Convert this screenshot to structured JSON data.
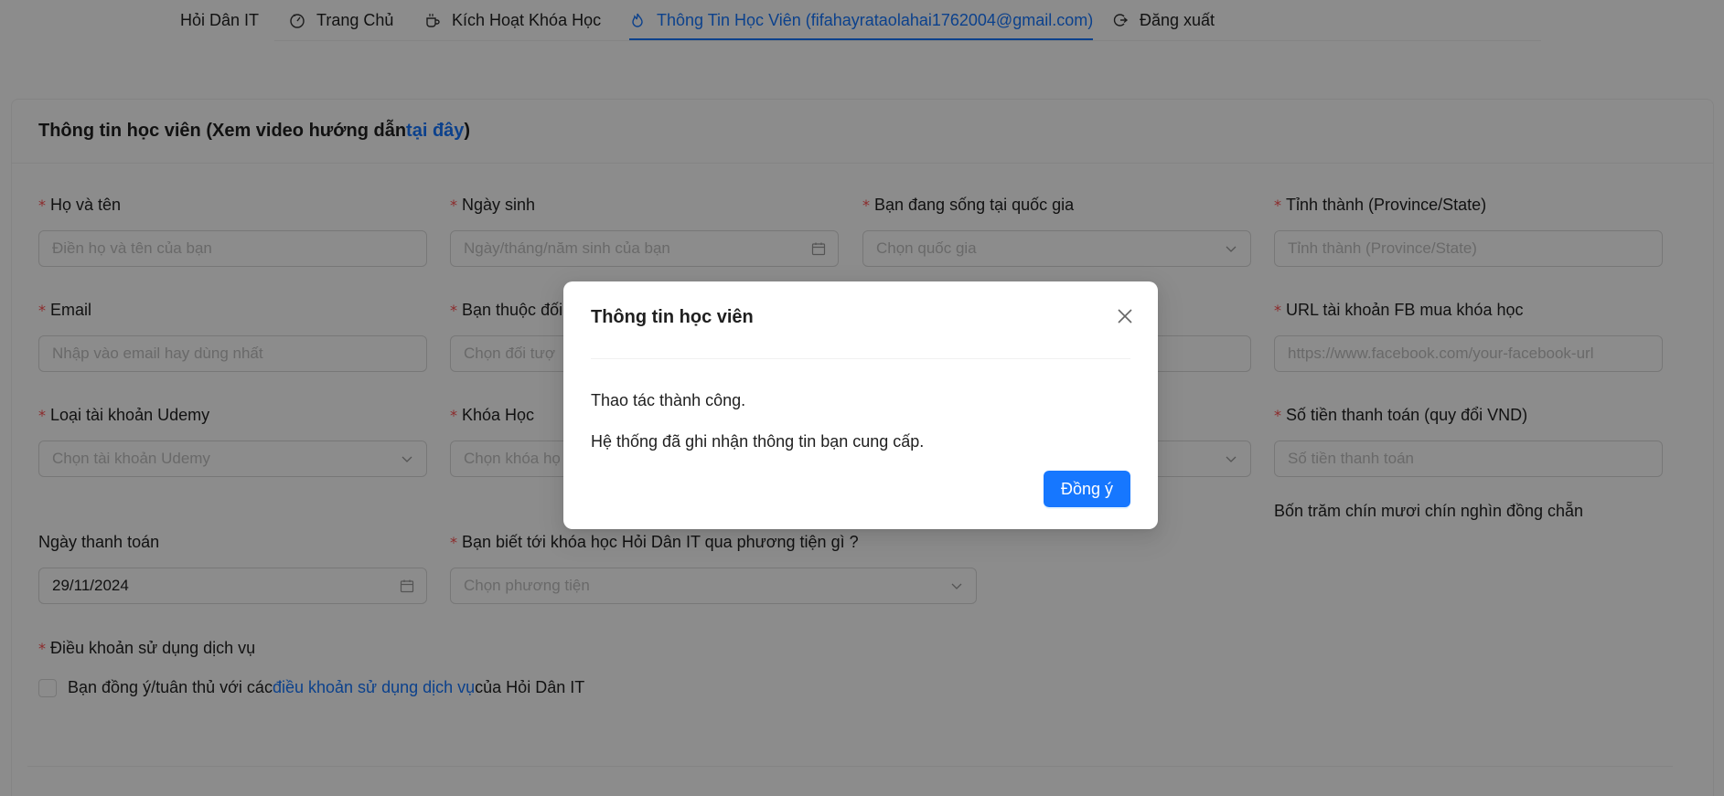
{
  "nav": {
    "items": [
      {
        "label": "Hỏi Dân IT",
        "icon": ""
      },
      {
        "label": "Trang Chủ",
        "icon": "dashboard-icon"
      },
      {
        "label": "Kích Hoạt Khóa Học",
        "icon": "coffee-icon"
      },
      {
        "label": "Thông Tin Học Viên (fifahayrataolahai1762004@gmail.com)",
        "icon": "fire-icon"
      },
      {
        "label": "Đăng xuất",
        "icon": "logout-icon"
      }
    ],
    "active_color": "#1677ff"
  },
  "card": {
    "title_prefix": "Thông tin học viên (Xem video hướng dẫn ",
    "title_link": "tại đây",
    "title_suffix": ")"
  },
  "form": {
    "full_name": {
      "label": "Họ và tên",
      "placeholder": "Điền họ và tên của bạn"
    },
    "birthday": {
      "label": "Ngày sinh",
      "placeholder": "Ngày/tháng/năm sinh của bạn"
    },
    "country": {
      "label": "Bạn đang sống tại quốc gia",
      "placeholder": "Chọn quốc gia"
    },
    "province": {
      "label": "Tỉnh thành (Province/State)",
      "placeholder": "Tỉnh thành (Province/State)"
    },
    "email": {
      "label": "Email",
      "placeholder": "Nhập vào email hay dùng nhất"
    },
    "audience": {
      "label": "Bạn thuộc đối",
      "placeholder": "Chọn đối tượ"
    },
    "fb_url": {
      "label": "URL tài khoản FB mua khóa học",
      "placeholder": "https://www.facebook.com/your-facebook-url"
    },
    "udemy_account": {
      "label": "Loại tài khoản Udemy",
      "placeholder": "Chọn tài khoản Udemy"
    },
    "course": {
      "label": "Khóa Học",
      "placeholder": "Chọn khóa họ"
    },
    "amount": {
      "label": "Số tiền thanh toán (quy đổi VND)",
      "placeholder": "Số tiền thanh toán",
      "in_words": "Bốn trăm chín mươi chín nghìn đồng chẵn"
    },
    "payment_date": {
      "label": "Ngày thanh toán",
      "value": "29/11/2024"
    },
    "source": {
      "label": "Bạn biết tới khóa học Hỏi Dân IT qua phương tiện gì ?",
      "placeholder": "Chọn phương tiện"
    },
    "terms": {
      "label": "Điều khoản sử dụng dịch vụ",
      "text_prefix": "Bạn đồng ý/tuân thủ với các ",
      "link": "điều khoản sử dụng dịch vụ",
      "text_suffix": " của Hỏi Dân IT"
    }
  },
  "modal": {
    "title": "Thông tin học viên",
    "line1": "Thao tác thành công.",
    "line2": "Hệ thống đã ghi nhận thông tin bạn cung cấp.",
    "ok_label": "Đồng ý"
  },
  "required_mark": "*"
}
